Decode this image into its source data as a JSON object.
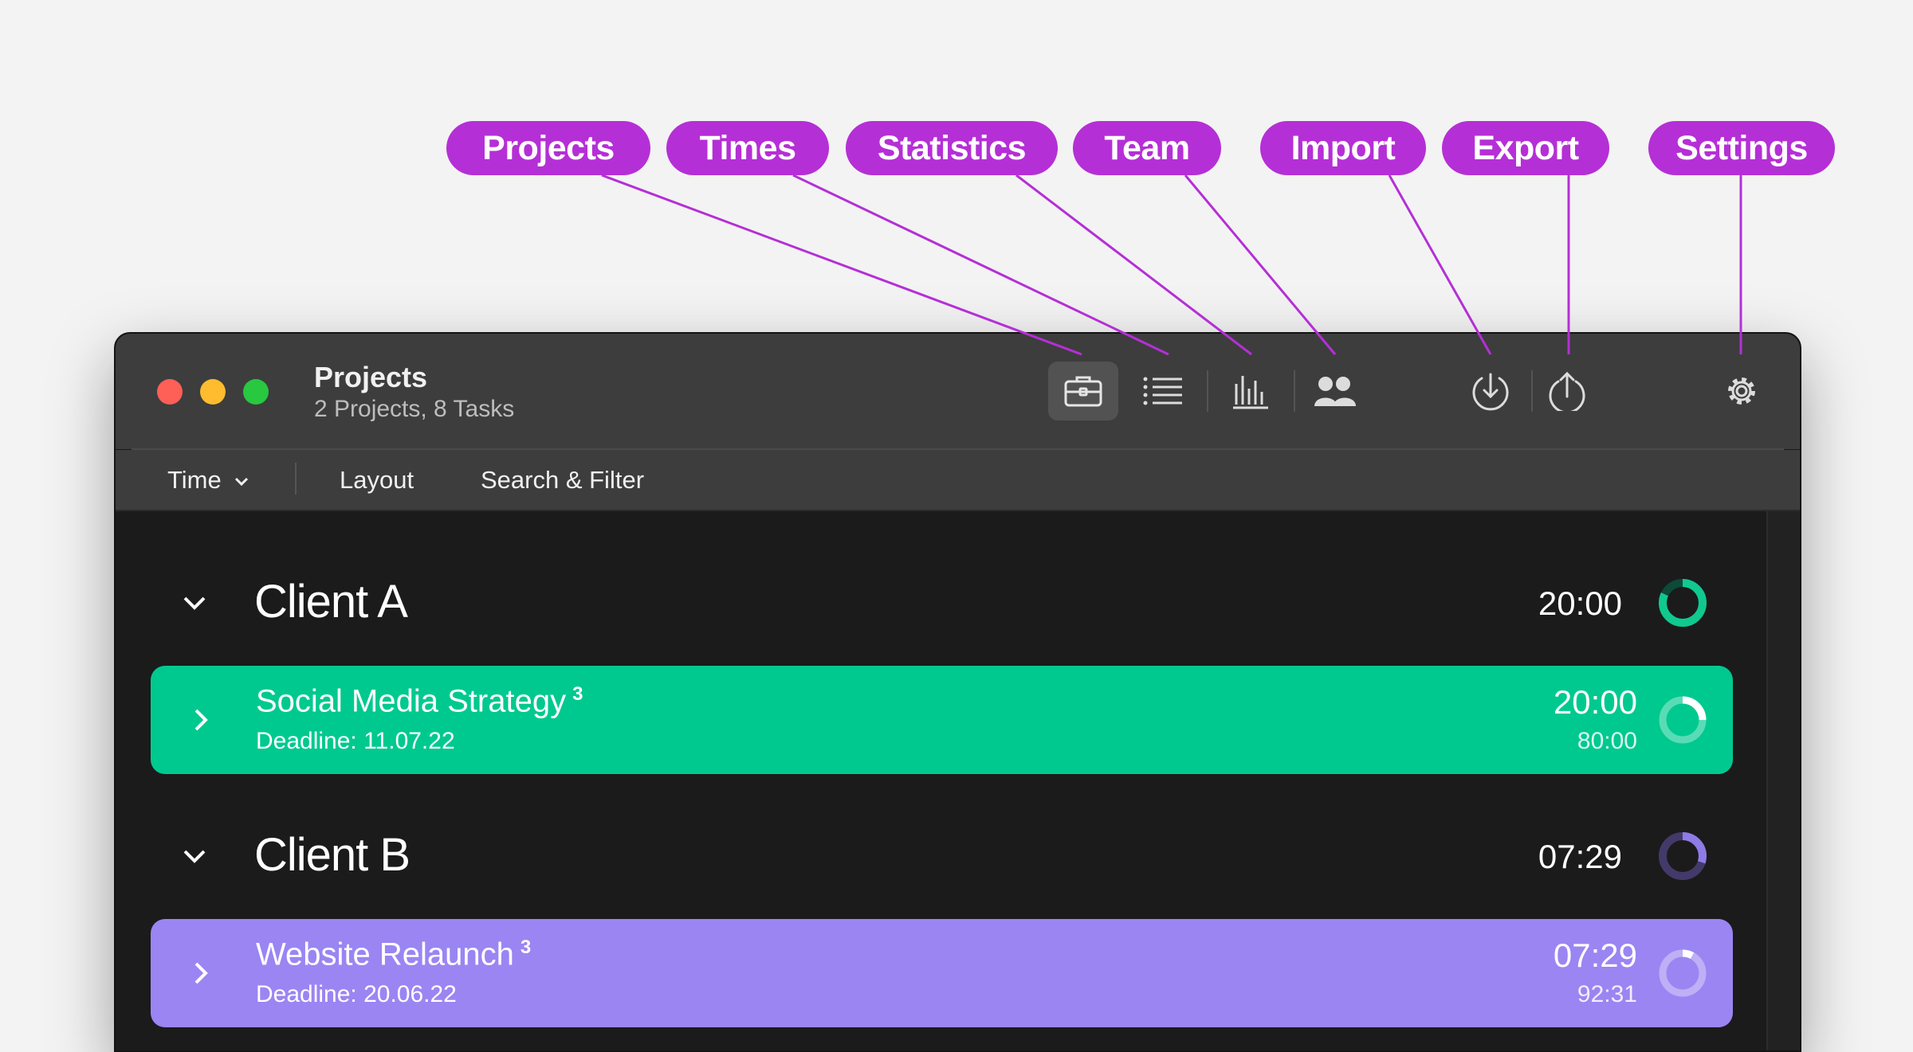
{
  "callouts": [
    "Projects",
    "Times",
    "Statistics",
    "Team",
    "Import",
    "Export",
    "Settings"
  ],
  "window": {
    "title": "Projects",
    "subtitle": "2 Projects, 8 Tasks"
  },
  "toolbar": {
    "icons": [
      "briefcase-icon",
      "list-icon",
      "bar-chart-icon",
      "team-icon",
      "import-icon",
      "export-icon",
      "gear-icon"
    ]
  },
  "subtoolbar": {
    "time": "Time",
    "layout": "Layout",
    "search": "Search & Filter"
  },
  "groups": [
    {
      "name": "Client A",
      "time": "20:00",
      "ring_color": "#10c98f",
      "ring_fraction": 0.82,
      "project": {
        "title": "Social Media Strategy",
        "count": "3",
        "deadline": "Deadline: 11.07.22",
        "time": "20:00",
        "total": "80:00",
        "color": "#00c98f",
        "progress": 0.25
      }
    },
    {
      "name": "Client B",
      "time": "07:29",
      "ring_color": "#8f7be6",
      "ring_fraction": 0.3,
      "project": {
        "title": "Website Relaunch",
        "count": "3",
        "deadline": "Deadline: 20.06.22",
        "time": "07:29",
        "total": "92:31",
        "color": "#9b85f2",
        "progress": 0.08
      }
    }
  ]
}
